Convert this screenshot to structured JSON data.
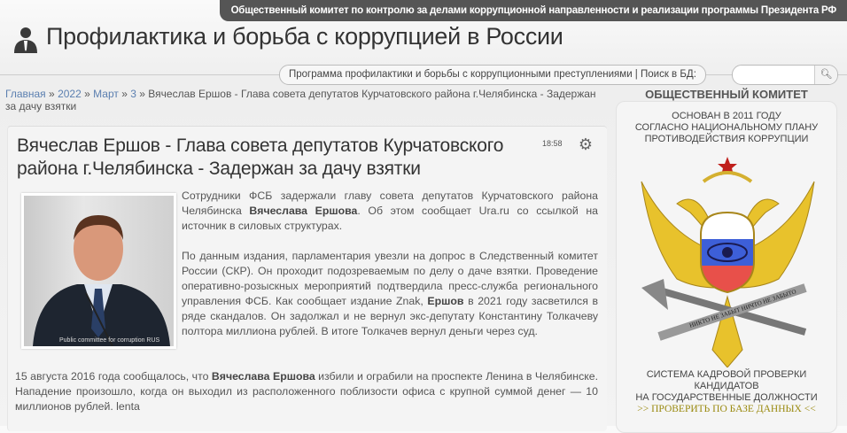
{
  "header": {
    "top_bar": "Общественный комитет по контролю за делами коррупционной направленности и реализации программы Президента РФ",
    "site_title": "Профилактика и борьба с коррупцией в России",
    "nav_pill": "Программа профилактики и борьбы с коррупционными преступлениями | Поиск в БД:",
    "search_placeholder": "",
    "search_icon": "magnifier"
  },
  "breadcrumb": {
    "items": [
      "Главная",
      "2022",
      "Март",
      "3"
    ],
    "sep": "»",
    "current": "Вячеслав Ершов - Глава совета депутатов Курчатовского района г.Челябинска - Задержан за дачу взятки"
  },
  "article": {
    "title": "Вячеслав Ершов - Глава совета депутатов Курчатовского района г.Челябинска - Задержан за дачу взятки",
    "time": "18:58",
    "photo_caption": "Public committee for corruption RUS",
    "p1": [
      "Сотрудники ФСБ задержали главу совета депутатов Курчатовского района Челябинска ",
      "Вячеслава Ершова",
      ". Об этом сообщает Ura.ru со ссылкой на источник в силовых структурах."
    ],
    "p2": [
      "По данным издания, парламентария увезли на допрос в Следственный комитет России (СКР). Он проходит подозреваемым по делу о даче взятки. Проведение оперативно-розыскных мероприятий подтвердила пресс-служба регионального управления ФСБ. Как сообщает издание Znak, ",
      "Ершов",
      " в 2021 году засветился в ряде скандалов. Он задолжал и не вернул экс-депутату Константину Толкачеву полтора миллиона рублей. В итоге Толкачев вернул деньги через суд."
    ],
    "p3": [
      "15 августа 2016 года сообщалось, что ",
      "Вячеслава Ершова",
      " избили и ограбили на проспекте Ленина в Челябинске. Нападение произошло, когда он выходил из расположенного поблизости офиса с крупной суммой денег — 10 миллионов рублей. lenta"
    ]
  },
  "sidebar": {
    "heading": "ОБЩЕСТВЕННЫЙ КОМИТЕТ",
    "intro": [
      "ОСНОВАН В 2011 ГОДУ",
      "СОГЛАСНО НАЦИОНАЛЬНОМУ ПЛАНУ",
      "ПРОТИВОДЕЙСТВИЯ КОРРУПЦИИ"
    ],
    "emblem_motto": "НИКТО НЕ ЗАБЫТ НИЧТО НЕ ЗАБЫТО",
    "system": [
      "СИСТЕМА КАДРОВОЙ ПРОВЕРКИ",
      "КАНДИДАТОВ",
      "НА ГОСУДАРСТВЕННЫЕ ДОЛЖНОСТИ"
    ],
    "link": ">> ПРОВЕРИТЬ ПО БАЗЕ ДАННЫХ <<"
  },
  "colors": {
    "top_bar": "#555555",
    "link": "#5b7fb0",
    "gold_link": "#9a8a10"
  }
}
